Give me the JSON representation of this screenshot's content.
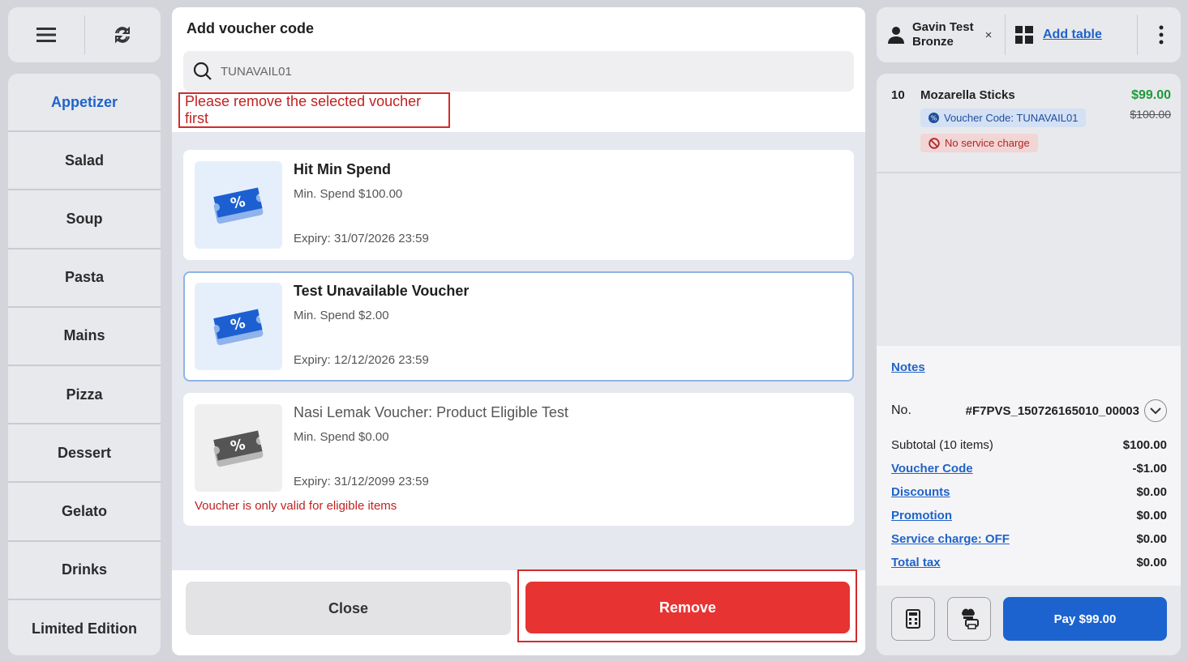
{
  "categories": [
    "Appetizer",
    "Salad",
    "Soup",
    "Pasta",
    "Mains",
    "Pizza",
    "Dessert",
    "Gelato",
    "Drinks",
    "Limited Edition"
  ],
  "customer": {
    "name": "Gavin Test",
    "tier": "Bronze",
    "remove": "×"
  },
  "add_table": "Add table",
  "order_item": {
    "qty": "10",
    "name": "Mozarella Sticks",
    "voucher_chip": "Voucher Code: TUNAVAIL01",
    "service_chip": "No service charge",
    "price": "$99.00",
    "original_price": "$100.00"
  },
  "notes": "Notes",
  "order_no": {
    "label": "No.",
    "value": "#F7PVS_150726165010_00003"
  },
  "summary": {
    "subtotal": {
      "label": "Subtotal (10 items)",
      "value": "$100.00"
    },
    "voucher": {
      "label": "Voucher Code",
      "value": "-$1.00"
    },
    "discounts": {
      "label": "Discounts",
      "value": "$0.00"
    },
    "promotion": {
      "label": "Promotion",
      "value": "$0.00"
    },
    "service": {
      "label": "Service charge: OFF",
      "value": "$0.00"
    },
    "tax": {
      "label": "Total tax",
      "value": "$0.00"
    }
  },
  "pay_label": "Pay $99.00",
  "modal": {
    "title": "Add voucher code",
    "search_value": "TUNAVAIL01",
    "error": "Please remove the selected voucher first",
    "vouchers": [
      {
        "title": "Hit Min Spend",
        "min": "Min. Spend $100.00",
        "expiry": "Expiry: 31/07/2026 23:59"
      },
      {
        "title": "Test Unavailable Voucher",
        "min": "Min. Spend $2.00",
        "expiry": "Expiry: 12/12/2026 23:59"
      },
      {
        "title": "Nasi Lemak Voucher: Product Eligible Test",
        "min": "Min. Spend $0.00",
        "expiry": "Expiry: 31/12/2099 23:59",
        "note": "Voucher is only valid for eligible items"
      }
    ],
    "close_label": "Close",
    "remove_label": "Remove"
  },
  "colors": {
    "accent": "#1f63c9",
    "danger": "#e83333",
    "success": "#1f9a3a"
  }
}
